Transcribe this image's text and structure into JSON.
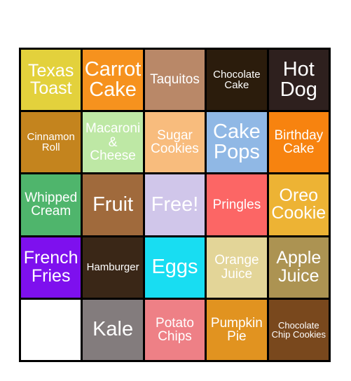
{
  "card": {
    "name": "food-bingo-card",
    "free_space_label": "Free!",
    "columns": 5,
    "rows": 5,
    "border_color": "#000000",
    "background_color": "#ffffff",
    "text_color": "#ffffff",
    "cells": [
      {
        "label": "Texas Toast",
        "color": "#E3D13C",
        "size": "fs-lg"
      },
      {
        "label": "Carrot Cake",
        "color": "#F6921E",
        "size": "fs-xl"
      },
      {
        "label": "Taquitos",
        "color": "#B98868",
        "size": "fs-md"
      },
      {
        "label": "Chocolate Cake",
        "color": "#2B1C0C",
        "size": "fs-sm"
      },
      {
        "label": "Hot Dog",
        "color": "#2E201E",
        "size": "fs-xl"
      },
      {
        "label": "Cinnamon Roll",
        "color": "#C4841E",
        "size": "fs-sm"
      },
      {
        "label": "Macaroni & Cheese",
        "color": "#BEE8A5",
        "size": "fs-md"
      },
      {
        "label": "Sugar Cookies",
        "color": "#F8BC7D",
        "size": "fs-md"
      },
      {
        "label": "Cake Pops",
        "color": "#90B8E5",
        "size": "fs-xl"
      },
      {
        "label": "Birthday Cake",
        "color": "#F7830F",
        "size": "fs-md"
      },
      {
        "label": "Whipped Cream",
        "color": "#4FB56C",
        "size": "fs-md"
      },
      {
        "label": "Fruit",
        "color": "#A06A3C",
        "size": "fs-xl"
      },
      {
        "label": "Free!",
        "color": "#D0C6EA",
        "size": "fs-xl"
      },
      {
        "label": "Pringles",
        "color": "#FC6665",
        "size": "fs-md"
      },
      {
        "label": "Oreo Cookie",
        "color": "#EDB334",
        "size": "fs-lg"
      },
      {
        "label": "French Fries",
        "color": "#7E10EE",
        "size": "fs-lg"
      },
      {
        "label": "Hamburger",
        "color": "#3A2717",
        "size": "fs-sm"
      },
      {
        "label": "Eggs",
        "color": "#18DDF2",
        "size": "fs-xl"
      },
      {
        "label": "Orange Juice",
        "color": "#E3D598",
        "size": "fs-md"
      },
      {
        "label": "Apple Juice",
        "color": "#AC9352",
        "size": "fs-lg"
      },
      {
        "label": "",
        "color": "#FFFFFF",
        "size": "fs-md"
      },
      {
        "label": "Kale",
        "color": "#837C7D",
        "size": "fs-xl"
      },
      {
        "label": "Potato Chips",
        "color": "#EE8086",
        "size": "fs-md"
      },
      {
        "label": "Pumpkin Pie",
        "color": "#E19320",
        "size": "fs-md"
      },
      {
        "label": "Chocolate Chip Cookies",
        "color": "#79481D",
        "size": "fs-xs"
      }
    ]
  }
}
